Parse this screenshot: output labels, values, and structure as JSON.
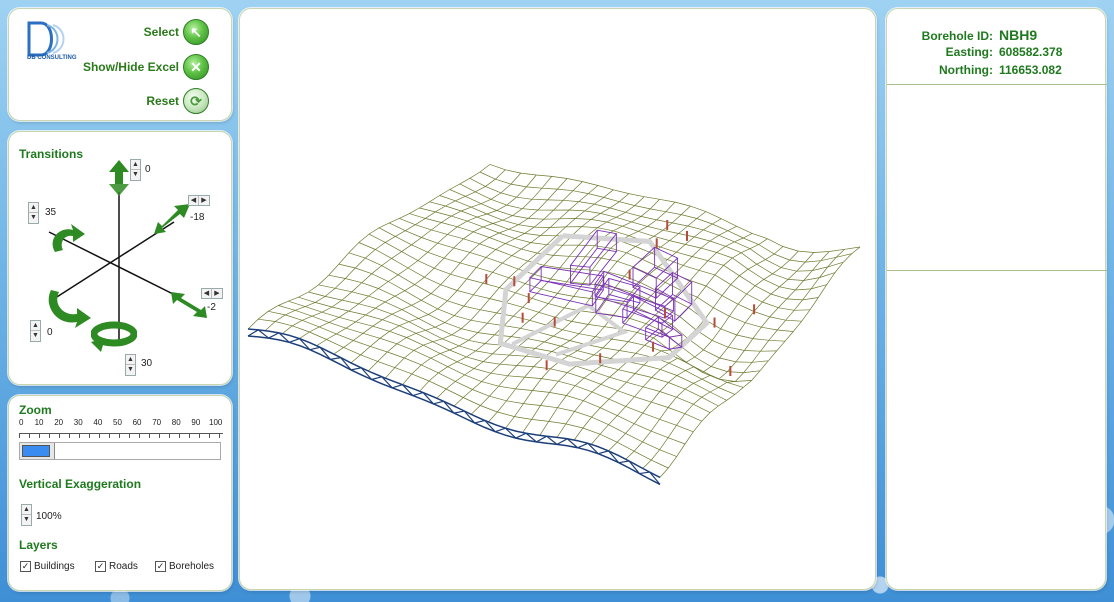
{
  "menu": {
    "logo_text": "DB CONSULTING",
    "select_label": "Select",
    "toggle_excel_label": "Show/Hide Excel",
    "reset_label": "Reset"
  },
  "transitions": {
    "title": "Transitions",
    "values": {
      "up": "0",
      "diag_right": "-18",
      "left_rotate": "35",
      "right_lower": "-2",
      "bottom_left": "0",
      "bottom": "30"
    }
  },
  "zoom": {
    "title": "Zoom",
    "ticks": [
      "0",
      "10",
      "20",
      "30",
      "40",
      "50",
      "60",
      "70",
      "80",
      "90",
      "100"
    ],
    "value_fraction": 0.15
  },
  "exaggeration": {
    "title": "Vertical Exaggeration",
    "value": "100",
    "unit": "%"
  },
  "layers": {
    "title": "Layers",
    "items": [
      {
        "label": "Buildings",
        "checked": true
      },
      {
        "label": "Roads",
        "checked": true
      },
      {
        "label": "Boreholes",
        "checked": true
      }
    ]
  },
  "info": {
    "borehole_key": "Borehole ID:",
    "borehole_val": "NBH9",
    "easting_key": "Easting:",
    "easting_val": "608582.378",
    "northing_key": "Northing:",
    "northing_val": "116653.082"
  },
  "colors": {
    "accent_green": "#1f7a1f",
    "mesh": "#6e7a2e",
    "edge_blue": "#1c3f7a",
    "buildings": "#7a2fb5",
    "roads": "#d4d4d4",
    "boreholes": "#b54c3a"
  }
}
